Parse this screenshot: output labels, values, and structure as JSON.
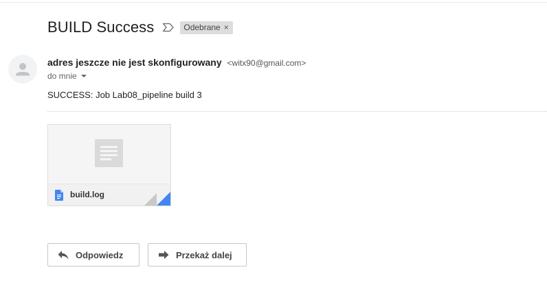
{
  "email": {
    "subject": "BUILD Success",
    "label": "Odebrane",
    "label_remove_glyph": "×",
    "sender_name": "adres jeszcze nie jest skonfigurowany",
    "sender_email": "<witx90@gmail.com>",
    "recipient": "do mnie",
    "body": "SUCCESS: Job Lab08_pipeline build 3"
  },
  "attachment": {
    "filename": "build.log",
    "file_icon": "google-docs-icon",
    "preview_icon": "document-thumbnail-icon"
  },
  "actions": {
    "reply_label": "Odpowiedz",
    "forward_label": "Przekaż dalej"
  },
  "colors": {
    "docs_blue": "#4285f4",
    "chip_bg": "#dddddd"
  }
}
